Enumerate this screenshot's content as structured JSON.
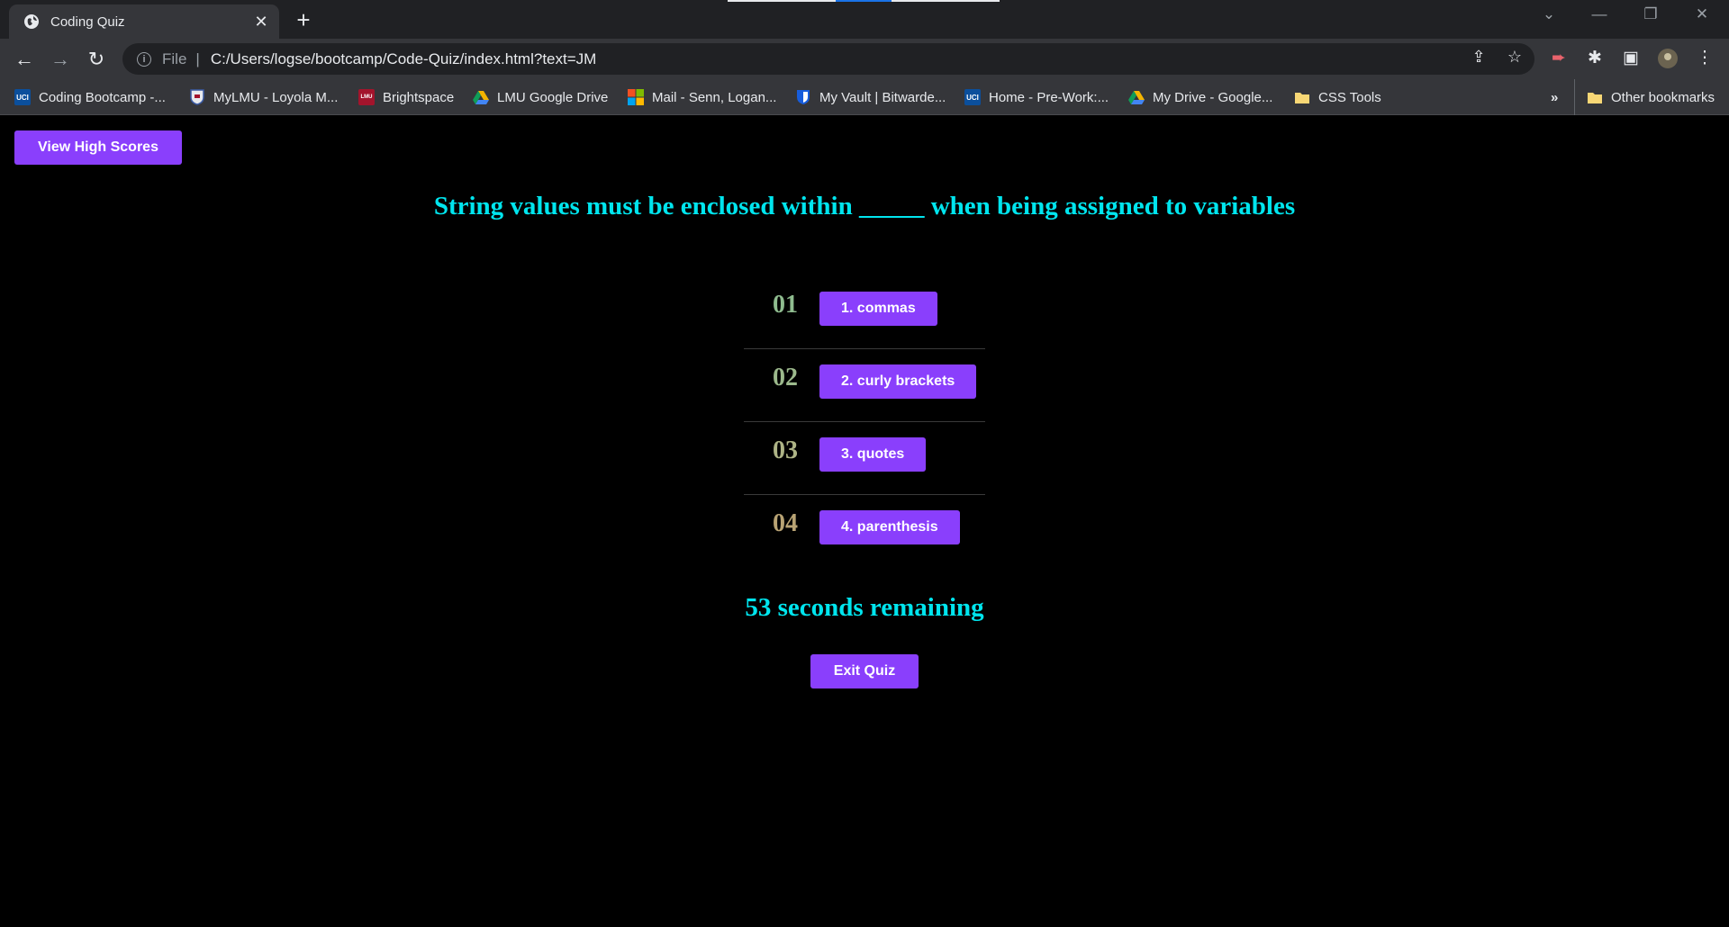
{
  "browser": {
    "tab": {
      "title": "Coding Quiz"
    },
    "address": {
      "scheme": "File",
      "url": "C:/Users/logse/bootcamp/Code-Quiz/index.html?text=JM"
    },
    "bookmarks": [
      {
        "label": "Coding Bootcamp -...",
        "icon": "uci-icon",
        "badge": "UCI",
        "color": "#0b4f9c"
      },
      {
        "label": "MyLMU - Loyola M...",
        "icon": "lmu-shield-icon",
        "badge": "",
        "color": "#3b5ba5"
      },
      {
        "label": "Brightspace",
        "icon": "lmu-brightspace-icon",
        "badge": "LMU",
        "color": "#a3142c"
      },
      {
        "label": "LMU Google Drive",
        "icon": "google-drive-icon",
        "badge": "",
        "color": "#f4b400"
      },
      {
        "label": "Mail - Senn, Logan...",
        "icon": "microsoft-icon",
        "badge": "",
        "color": "#f25022"
      },
      {
        "label": "My Vault | Bitwarde...",
        "icon": "bitwarden-icon",
        "badge": "",
        "color": "#175ddc"
      },
      {
        "label": "Home - Pre-Work:...",
        "icon": "uci-icon",
        "badge": "UCI",
        "color": "#0b4f9c"
      },
      {
        "label": "My Drive - Google...",
        "icon": "google-drive-icon",
        "badge": "",
        "color": "#f4b400"
      },
      {
        "label": "CSS Tools",
        "icon": "folder-icon",
        "badge": "",
        "color": "#f8d775"
      }
    ],
    "overflow": "»",
    "other_bookmarks": "Other bookmarks"
  },
  "page": {
    "high_scores_label": "View High Scores",
    "question": "String values must be enclosed within _____ when being assigned to variables",
    "choices": [
      {
        "num": "01",
        "label": "1. commas",
        "num_color": "#8fbc8f"
      },
      {
        "num": "02",
        "label": "2. curly brackets",
        "num_color": "#9cb98c"
      },
      {
        "num": "03",
        "label": "3. quotes",
        "num_color": "#aeb486"
      },
      {
        "num": "04",
        "label": "4. parenthesis",
        "num_color": "#b8a374"
      }
    ],
    "timer": "53 seconds remaining",
    "exit_label": "Exit Quiz"
  },
  "colors": {
    "accent": "#8a3ffc",
    "heading": "#00e5ee",
    "background": "#000000"
  }
}
